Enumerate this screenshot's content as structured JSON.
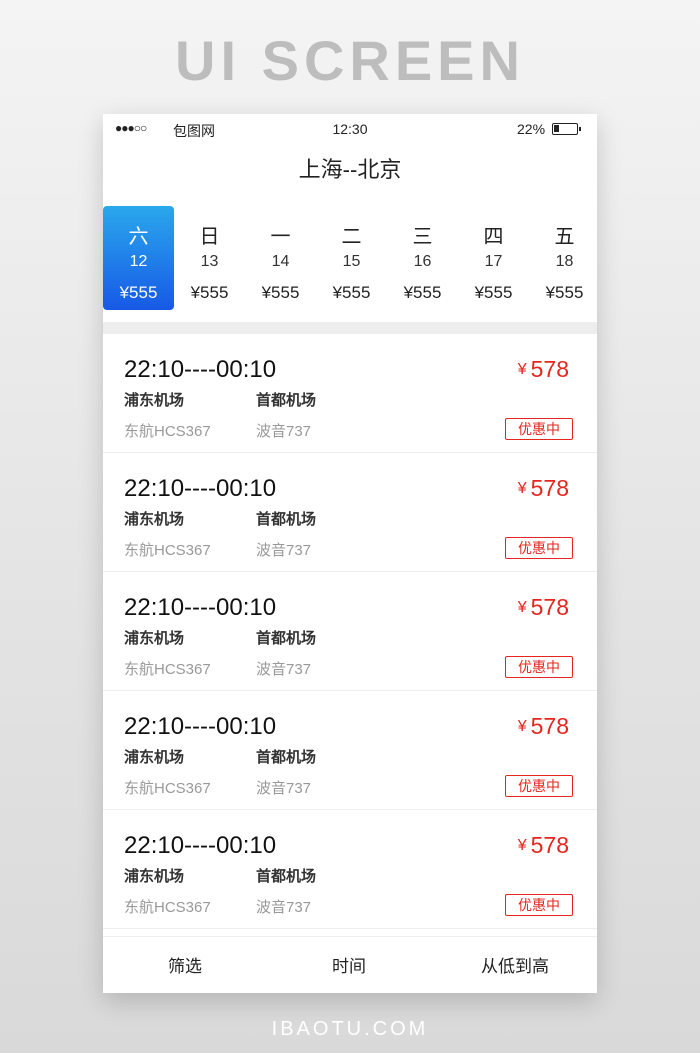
{
  "showcase": {
    "title": "UI SCREEN",
    "footer": "IBAOTU.COM"
  },
  "status_bar": {
    "signal": "●●●○○",
    "carrier": "包图网",
    "time": "12:30",
    "battery": "22%"
  },
  "header": {
    "title": "上海--北京"
  },
  "dates": [
    {
      "weekday": "六",
      "day": "12",
      "price": "¥555",
      "selected": true
    },
    {
      "weekday": "日",
      "day": "13",
      "price": "¥555",
      "selected": false
    },
    {
      "weekday": "一",
      "day": "14",
      "price": "¥555",
      "selected": false
    },
    {
      "weekday": "二",
      "day": "15",
      "price": "¥555",
      "selected": false
    },
    {
      "weekday": "三",
      "day": "16",
      "price": "¥555",
      "selected": false
    },
    {
      "weekday": "四",
      "day": "17",
      "price": "¥555",
      "selected": false
    },
    {
      "weekday": "五",
      "day": "18",
      "price": "¥555",
      "selected": false
    }
  ],
  "flights": [
    {
      "times": "22:10----00:10",
      "from": "浦东机场",
      "to": "首都机场",
      "airline": "东航HCS367",
      "aircraft": "波音737",
      "currency": "¥",
      "price": "578",
      "badge": "优惠中"
    },
    {
      "times": "22:10----00:10",
      "from": "浦东机场",
      "to": "首都机场",
      "airline": "东航HCS367",
      "aircraft": "波音737",
      "currency": "¥",
      "price": "578",
      "badge": "优惠中"
    },
    {
      "times": "22:10----00:10",
      "from": "浦东机场",
      "to": "首都机场",
      "airline": "东航HCS367",
      "aircraft": "波音737",
      "currency": "¥",
      "price": "578",
      "badge": "优惠中"
    },
    {
      "times": "22:10----00:10",
      "from": "浦东机场",
      "to": "首都机场",
      "airline": "东航HCS367",
      "aircraft": "波音737",
      "currency": "¥",
      "price": "578",
      "badge": "优惠中"
    },
    {
      "times": "22:10----00:10",
      "from": "浦东机场",
      "to": "首都机场",
      "airline": "东航HCS367",
      "aircraft": "波音737",
      "currency": "¥",
      "price": "578",
      "badge": "优惠中"
    }
  ],
  "bottom_bar": {
    "filter": "筛选",
    "time": "时间",
    "sort": "从低到高"
  },
  "colors": {
    "accent_blue": "#1759e6",
    "accent_light_blue": "#2aa8ec",
    "price_red": "#e4261e"
  }
}
